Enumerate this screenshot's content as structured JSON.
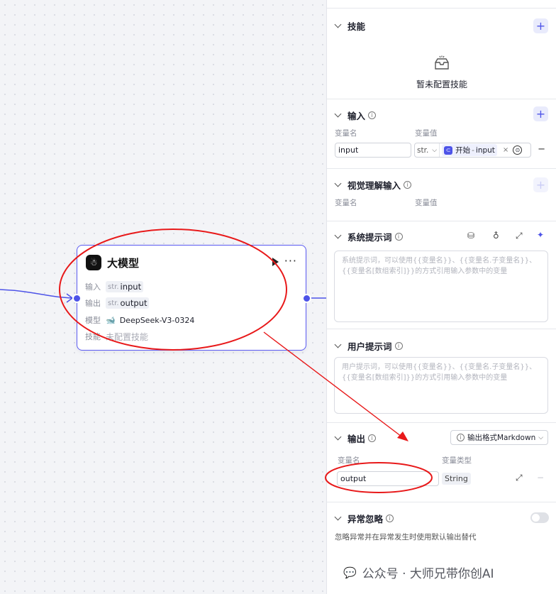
{
  "node": {
    "title": "大模型",
    "more_glyph": "···",
    "input_label": "输入",
    "input_type": "str.",
    "input_name": "input",
    "output_label": "输出",
    "output_type": "str.",
    "output_name": "output",
    "model_label": "模型",
    "model_name": "DeepSeek-V3-0324",
    "skill_label": "技能",
    "skill_value": "未配置技能"
  },
  "panel": {
    "skills": {
      "title": "技能",
      "empty_text": "暂未配置技能"
    },
    "inputs": {
      "title": "输入",
      "col_name": "变量名",
      "col_value": "变量值",
      "var_name": "input",
      "type_value": "str.",
      "ref_source": "开始",
      "ref_separator": "-",
      "ref_var": "input"
    },
    "vision": {
      "title": "视觉理解输入",
      "col_name": "变量名",
      "col_value": "变量值"
    },
    "system_prompt": {
      "title": "系统提示词",
      "placeholder": "系统提示词，可以使用{{变量名}}、{{变量名.子变量名}}、{{变量名[数组索引]}}的方式引用输入参数中的变量"
    },
    "user_prompt": {
      "title": "用户提示词",
      "placeholder": "用户提示词，可以使用{{变量名}}、{{变量名.子变量名}}、{{变量名[数组索引]}}的方式引用输入参数中的变量"
    },
    "outputs": {
      "title": "输出",
      "format_label": "输出格式",
      "format_value": "Markdown",
      "col_name": "变量名",
      "col_type": "变量类型",
      "var_name": "output",
      "var_type": "String"
    },
    "exception": {
      "title": "异常忽略",
      "description": "忽略异常并在异常发生时使用默认输出替代",
      "toggle_on": false
    }
  },
  "watermark": {
    "text": "公众号 · 大师兄带你创AI"
  },
  "colors": {
    "accent": "#4d53e8",
    "annotation": "#e8191a"
  }
}
